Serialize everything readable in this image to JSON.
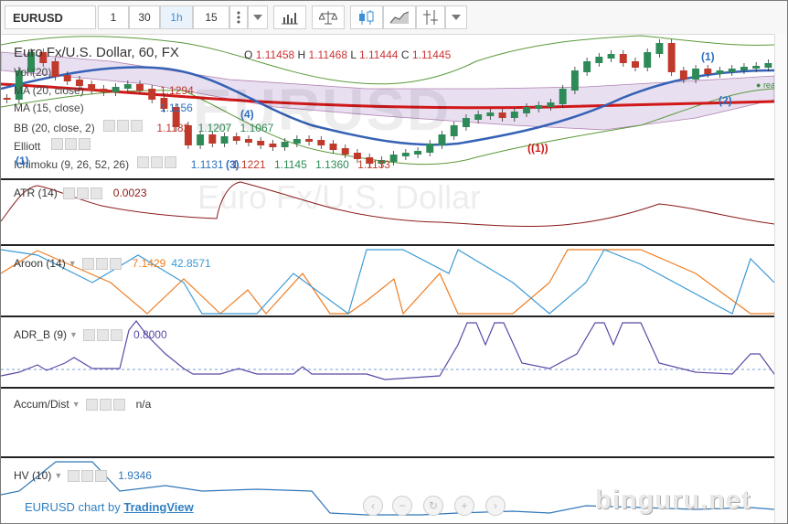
{
  "toolbar": {
    "symbol": "EURUSD",
    "intervals": [
      "1",
      "30",
      "1h",
      "15"
    ],
    "active_interval": "1h",
    "icons": [
      "more-icon",
      "chevron-down-icon",
      "bar-chart-icon",
      "compare-icon",
      "candlestick-icon",
      "area-chart-icon",
      "indicators-icon",
      "chevron-down-icon"
    ]
  },
  "main": {
    "title": "Euro Fx/U.S. Dollar, 60, FX",
    "ohlc": {
      "o_label": "O",
      "o": "1.11458",
      "h_label": "H",
      "h": "1.11468",
      "l_label": "L",
      "l": "1.11444",
      "c_label": "C",
      "c": "1.11445"
    },
    "watermark": "EURUSD",
    "watermark_sub": "Euro Fx/U.S. Dollar",
    "realtime": "realtime",
    "indicators": [
      {
        "label": "Vol (20)"
      },
      {
        "label": "MA (20, close)",
        "value": "1.1294",
        "color": "#c0392b"
      },
      {
        "label": "MA (15, close)",
        "value": "1.1156",
        "color": "#2e6fbd"
      },
      {
        "label": "BB (20, close, 2)",
        "value1": "1.1182",
        "value2": "1.1207",
        "value3": "1.1067"
      },
      {
        "label": "Elliott"
      },
      {
        "label": "Ichimoku (9, 26, 52, 26)",
        "value1": "1.1131",
        "value2": "1.1221",
        "value3": "1.1145",
        "value4": "1.1360",
        "value5": "1.1133"
      }
    ],
    "elliott_labels": [
      "(1)",
      "(3)",
      "(4)",
      "((1))",
      "(1)",
      "(2)"
    ]
  },
  "panes": {
    "atr": {
      "label": "ATR (14)",
      "value": "0.0023"
    },
    "aroon": {
      "label": "Aroon (14)",
      "value_up": "7.1429",
      "value_down": "42.8571"
    },
    "adr_b": {
      "label": "ADR_B (9)",
      "value": "0.8000"
    },
    "accum": {
      "label": "Accum/Dist",
      "value": "n/a"
    },
    "hv": {
      "label": "HV (10)",
      "value": "1.9346"
    }
  },
  "footer": {
    "brand_prefix": "EURUSD chart by ",
    "brand_link": "TradingView",
    "site": "binguru.net"
  },
  "colors": {
    "up": "#2e8b57",
    "down": "#c0392b",
    "ma20": "#d01818",
    "ma15": "#3562b5",
    "aroon_up": "#ef7d22",
    "aroon_down": "#3c9ad6",
    "adr": "#5b4aa5",
    "atr": "#8b1a1a",
    "hv": "#2f77b8"
  }
}
